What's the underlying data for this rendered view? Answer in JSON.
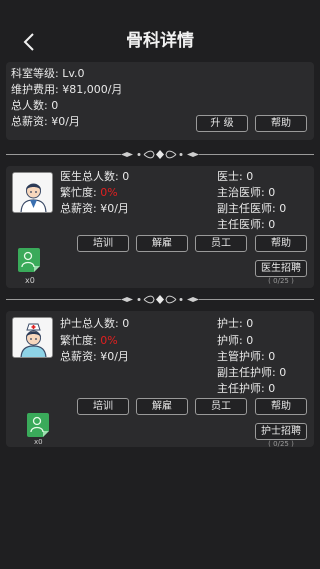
{
  "header": {
    "title": "骨科详情"
  },
  "summary": {
    "level": "科室等级: Lv.0",
    "maintenance": "维护费用: ¥81,000/月",
    "total_people": "总人数: 0",
    "total_salary": "总薪资: ¥0/月",
    "upgrade_label": "升 级",
    "help_label": "帮助"
  },
  "doctor": {
    "total": "医生总人数: 0",
    "busy_label": "繁忙度: ",
    "busy_value": "0%",
    "salary": "总薪资: ¥0/月",
    "ranks": [
      "医士: 0",
      "主治医师: 0",
      "副主任医师: 0",
      "主任医师: 0"
    ],
    "badge_count": "x0",
    "buttons": [
      "培训",
      "解雇",
      "员工",
      "帮助"
    ],
    "recruit_label": "医生招聘",
    "recruit_count": "( 0/25 )"
  },
  "nurse": {
    "total": "护士总人数: 0",
    "busy_label": "繁忙度: ",
    "busy_value": "0%",
    "salary": "总薪资: ¥0/月",
    "ranks": [
      "护士: 0",
      "护师: 0",
      "主管护师: 0",
      "副主任护师: 0",
      "主任护师: 0"
    ],
    "badge_count": "x0",
    "buttons": [
      "培训",
      "解雇",
      "员工",
      "帮助"
    ],
    "recruit_label": "护士招聘",
    "recruit_count": "( 0/25 )"
  },
  "colors": {
    "background": "#1f1f21",
    "panel": "#2b2b2d",
    "busy": "#e02020",
    "badge": "#3aaa5a"
  }
}
